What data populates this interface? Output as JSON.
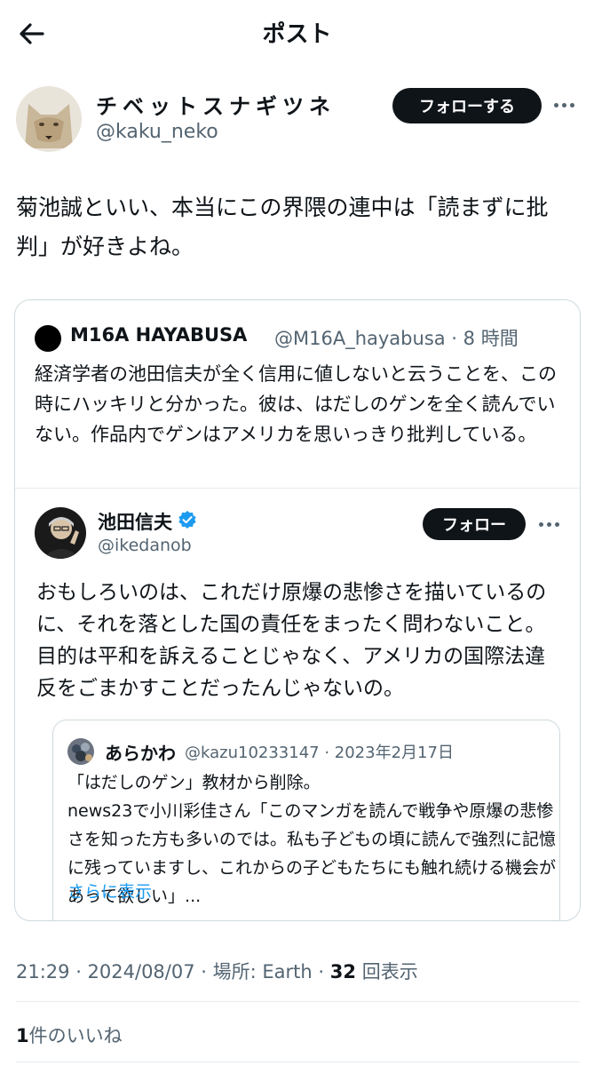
{
  "header": {
    "title": "ポスト",
    "back_icon": "arrow-left-icon"
  },
  "author": {
    "name": "チベットスナギツネ",
    "handle": "@kaku_neko",
    "follow_label": "フォローする",
    "avatar_icon": "fox-avatar"
  },
  "post": {
    "text": "菊池誠といい、本当にこの界隈の連中は「読まずに批判」が好きよね。"
  },
  "quote": {
    "name": "M16A  HAYABUSA",
    "handle_time": "@M16A_hayabusa · 8 時間",
    "text": "経済学者の池田信夫が全く信用に値しないと云うことを、この時にハッキリと分かった。彼は、はだしのゲンを全く読んでいない。作品内でゲンはアメリカを思いっきり批判している。",
    "inner": {
      "name": "池田信夫",
      "handle": "@ikedanob",
      "follow_label": "フォロー",
      "verified_icon": "verified-badge-icon",
      "text": "おもしろいのは、これだけ原爆の悲惨さを描いているのに、それを落とした国の責任をまったく問わないこと。目的は平和を訴えることじゃなく、アメリカの国際法違反をごまかすことだったんじゃないの。",
      "nested": {
        "name": "あらかわ",
        "handle_date": "@kazu10233147 · 2023年2月17日",
        "line1": "「はだしのゲン」教材から削除。",
        "line2": "news23で小川彩佳さん「このマンガを読んで戦争や原爆の悲惨さを知った方も多いのでは。私も子どもの頃に読んで強烈に記憶に残っていますし、これからの子どもたちにも触れ続ける機会があって欲しい」...",
        "show_more": "さらに表示"
      }
    }
  },
  "meta": {
    "time_date": "21:29 · 2024/08/07",
    "location": "場所: Earth",
    "sep": "·",
    "views_count": "32",
    "views_label": "回表示"
  },
  "likes": {
    "count": "1",
    "label": "件のいいね"
  },
  "colors": {
    "text": "#0f1419",
    "secondary": "#536471",
    "link": "#1d9bf0",
    "verified": "#1d9bf0"
  }
}
